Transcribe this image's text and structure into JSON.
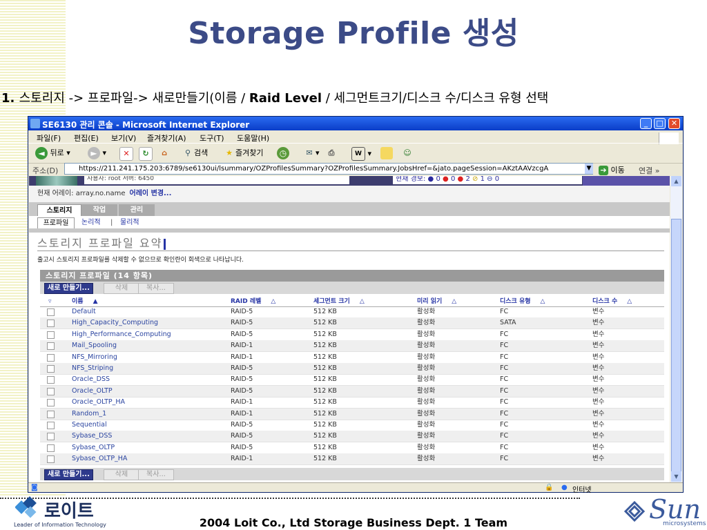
{
  "slide": {
    "title": "Storage Profile 생성",
    "subtitle_prefix": "1. ",
    "subtitle_part1": "스토리지 -> 프로파일-> ",
    "subtitle_part2": "새로만들기(이름 / ",
    "subtitle_bold": "Raid Level",
    "subtitle_part3": " / 세그먼트크기/디스크 수/디스크 유형 선택",
    "footer": "2004 Loit Co., Ltd Storage Business Dept. 1 Team",
    "left_logo_text": "로이트",
    "left_logo_tagline": "Leader of Information Technology",
    "right_logo_text": "Sun",
    "right_logo_tagline": "microsystems"
  },
  "window": {
    "title": "SE6130 관리 콘솔 - Microsoft Internet Explorer",
    "menu": [
      "파일(F)",
      "편집(E)",
      "보기(V)",
      "즐겨찾기(A)",
      "도구(T)",
      "도움말(H)"
    ],
    "toolbar": {
      "back": "뒤로",
      "search": "검색",
      "favorites": "즐겨찾기"
    },
    "address_label": "주소(D)",
    "address_url": "https://211.241.175.203:6789/se6130ui/lsummary/OZProfilesSummary?OZProfilesSummary.JobsHref=&jato.pageSession=AKztAAVzcgA",
    "go_label": "이동",
    "links_label": "연결",
    "status_zone": "인터넷"
  },
  "app": {
    "user_text": "사용자: root   서버: 6450",
    "alert_label": "현재 경보:",
    "alerts": {
      "down": "0",
      "critical": "0",
      "major": "2",
      "minor": "1",
      "other": "0"
    },
    "current_array_label": "현재 어레이: array.no.name",
    "change_array_label": "어레이 변경...",
    "tabs": [
      "스토리지",
      "작업",
      "관리"
    ],
    "subtabs": [
      "프로파일",
      "논리적",
      "물리적"
    ],
    "subtab_sep": "|",
    "page_title": "스토리지 프로파일 요약",
    "page_desc": "출고시 스토리지 프로파일를 삭제할 수 없으므로 확인란이 회색으로 나타납니다.",
    "table_title": "스토리지 프로파일 (14 항목)",
    "actions": {
      "new": "새로 만들기...",
      "delete": "삭제",
      "copy": "복사..."
    },
    "columns": [
      "이름",
      "RAID 레벨",
      "세그먼트 크기",
      "미리 읽기",
      "디스크 유형",
      "디스크 수"
    ],
    "rows": [
      {
        "name": "Default",
        "raid": "RAID-5",
        "seg": "512 KB",
        "read": "활성화",
        "type": "FC",
        "count": "변수"
      },
      {
        "name": "High_Capacity_Computing",
        "raid": "RAID-5",
        "seg": "512 KB",
        "read": "활성화",
        "type": "SATA",
        "count": "변수"
      },
      {
        "name": "High_Performance_Computing",
        "raid": "RAID-5",
        "seg": "512 KB",
        "read": "활성화",
        "type": "FC",
        "count": "변수"
      },
      {
        "name": "Mail_Spooling",
        "raid": "RAID-1",
        "seg": "512 KB",
        "read": "활성화",
        "type": "FC",
        "count": "변수"
      },
      {
        "name": "NFS_Mirroring",
        "raid": "RAID-1",
        "seg": "512 KB",
        "read": "활성화",
        "type": "FC",
        "count": "변수"
      },
      {
        "name": "NFS_Striping",
        "raid": "RAID-5",
        "seg": "512 KB",
        "read": "활성화",
        "type": "FC",
        "count": "변수"
      },
      {
        "name": "Oracle_DSS",
        "raid": "RAID-5",
        "seg": "512 KB",
        "read": "활성화",
        "type": "FC",
        "count": "변수"
      },
      {
        "name": "Oracle_OLTP",
        "raid": "RAID-5",
        "seg": "512 KB",
        "read": "활성화",
        "type": "FC",
        "count": "변수"
      },
      {
        "name": "Oracle_OLTP_HA",
        "raid": "RAID-1",
        "seg": "512 KB",
        "read": "활성화",
        "type": "FC",
        "count": "변수"
      },
      {
        "name": "Random_1",
        "raid": "RAID-1",
        "seg": "512 KB",
        "read": "활성화",
        "type": "FC",
        "count": "변수"
      },
      {
        "name": "Sequential",
        "raid": "RAID-5",
        "seg": "512 KB",
        "read": "활성화",
        "type": "FC",
        "count": "변수"
      },
      {
        "name": "Sybase_DSS",
        "raid": "RAID-5",
        "seg": "512 KB",
        "read": "활성화",
        "type": "FC",
        "count": "변수"
      },
      {
        "name": "Sybase_OLTP",
        "raid": "RAID-5",
        "seg": "512 KB",
        "read": "활성화",
        "type": "FC",
        "count": "변수"
      },
      {
        "name": "Sybase_OLTP_HA",
        "raid": "RAID-1",
        "seg": "512 KB",
        "read": "활성화",
        "type": "FC",
        "count": "변수"
      }
    ]
  }
}
